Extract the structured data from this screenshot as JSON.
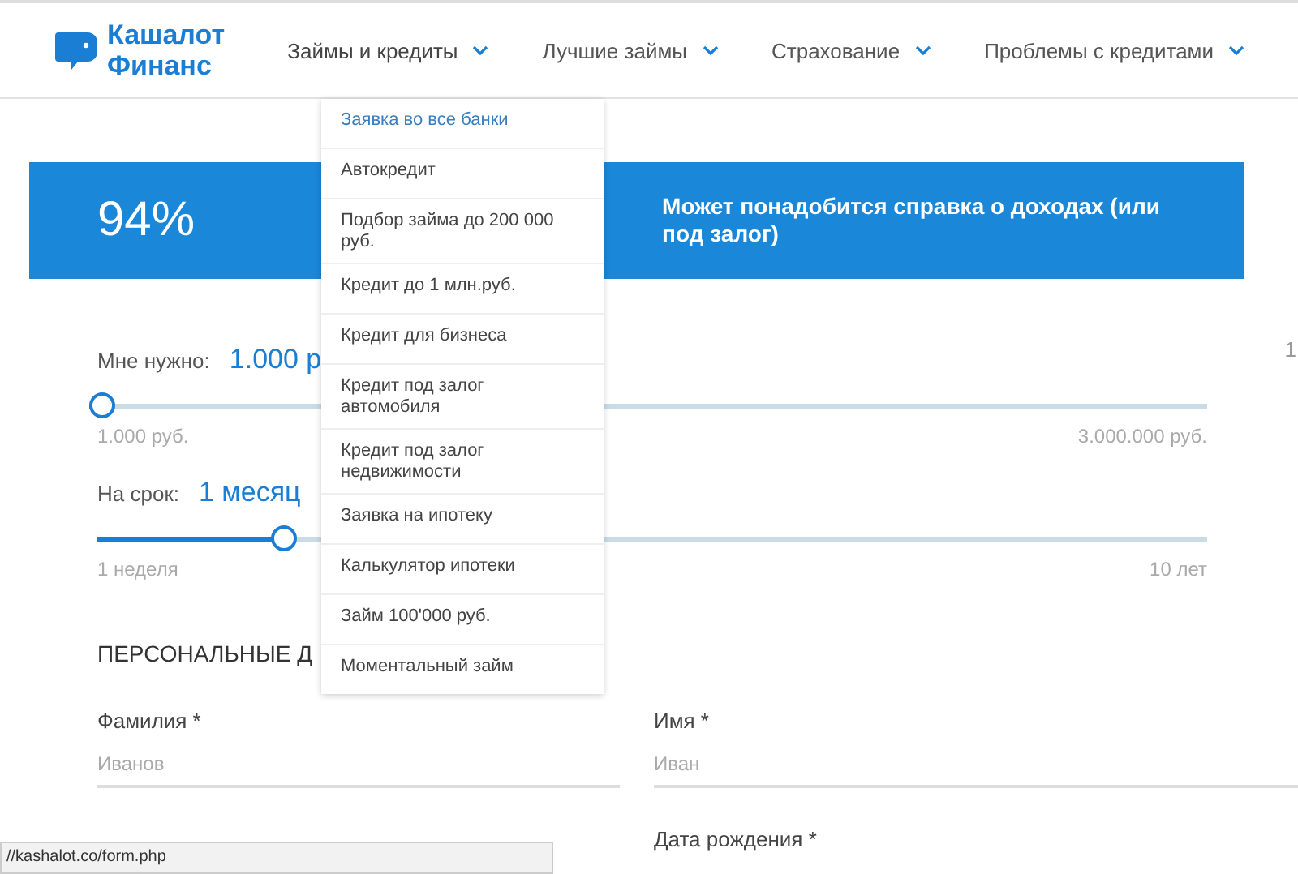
{
  "logo": {
    "line1": "Кашалот",
    "line2": "Финанс"
  },
  "nav": [
    {
      "label": "Займы и кредиты",
      "expanded": true
    },
    {
      "label": "Лучшие займы",
      "expanded": false
    },
    {
      "label": "Страхование",
      "expanded": false
    },
    {
      "label": "Проблемы с кредитами",
      "expanded": false
    }
  ],
  "dropdown": [
    {
      "label": "Заявка во все банки",
      "selected": true
    },
    {
      "label": "Автокредит",
      "selected": false
    },
    {
      "label": "Подбор займа до 200 000 руб.",
      "selected": false
    },
    {
      "label": "Кредит до 1 млн.руб.",
      "selected": false
    },
    {
      "label": "Кредит для бизнеса",
      "selected": false
    },
    {
      "label": "Кредит под залог автомобиля",
      "selected": false
    },
    {
      "label": "Кредит под залог недвижимости",
      "selected": false
    },
    {
      "label": "Заявка на ипотеку",
      "selected": false
    },
    {
      "label": "Калькулятор ипотеки",
      "selected": false
    },
    {
      "label": "Займ 100'000 руб.",
      "selected": false
    },
    {
      "label": "Моментальный займ",
      "selected": false
    }
  ],
  "banner": {
    "percent": "94%",
    "note": "Может понадобится справка о доходах (или под залог)"
  },
  "side_text": "1",
  "sliders": [
    {
      "label": "Мне нужно:",
      "value": "1.000 р",
      "level": 0,
      "min": "1.000 руб.",
      "max": "3.000.000 руб."
    },
    {
      "label": "На срок:",
      "value": "1 месяц",
      "level": 0.16,
      "min": "1 неделя",
      "max": "10 лет"
    }
  ],
  "section_title": "ПЕРСОНАЛЬНЫЕ Д",
  "fields": [
    {
      "label": "Фамилия *",
      "placeholder": "Иванов"
    },
    {
      "label": "Имя *",
      "placeholder": "Иван"
    }
  ],
  "next_fields": [
    "Дата рождения *"
  ],
  "status_bar": "//kashalot.co/form.php"
}
